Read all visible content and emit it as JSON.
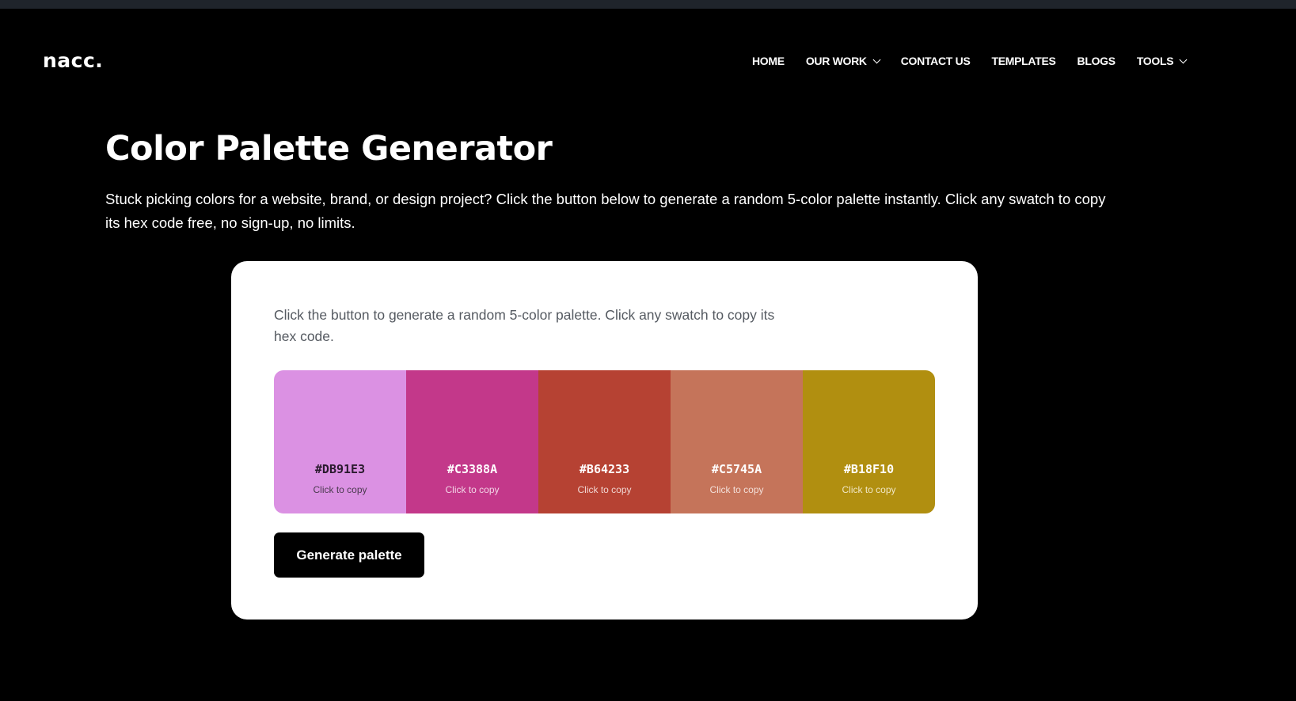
{
  "brand": {
    "logo": "nacc."
  },
  "nav": {
    "items": [
      {
        "label": "HOME",
        "dropdown": false
      },
      {
        "label": "OUR WORK",
        "dropdown": true
      },
      {
        "label": "CONTACT US",
        "dropdown": false
      },
      {
        "label": "TEMPLATES",
        "dropdown": false
      },
      {
        "label": "BLOGS",
        "dropdown": false
      },
      {
        "label": "TOOLS",
        "dropdown": true
      }
    ]
  },
  "main": {
    "title": "Color Palette Generator",
    "intro": "Stuck picking colors for a website, brand, or design project? Click the button below to generate a random 5-color palette instantly. Click any swatch to copy its hex code free, no sign-up, no limits."
  },
  "tool": {
    "description": "Click the button to generate a random 5-color palette. Click any swatch to copy its hex code.",
    "swatches": [
      {
        "hex": "#DB91E3",
        "color": "#DB91E3",
        "text_color": "#2a1a2e",
        "sub_color": "#4a3a4e",
        "copy_label": "Click to copy"
      },
      {
        "hex": "#C3388A",
        "color": "#C3388A",
        "text_color": "#ffffff",
        "sub_color": "#f2d5e6",
        "copy_label": "Click to copy"
      },
      {
        "hex": "#B64233",
        "color": "#B64233",
        "text_color": "#ffffff",
        "sub_color": "#f0d5d1",
        "copy_label": "Click to copy"
      },
      {
        "hex": "#C5745A",
        "color": "#C5745A",
        "text_color": "#ffffff",
        "sub_color": "#f3dfd8",
        "copy_label": "Click to copy"
      },
      {
        "hex": "#B18F10",
        "color": "#B18F10",
        "text_color": "#ffffff",
        "sub_color": "#f1e7c5",
        "copy_label": "Click to copy"
      }
    ],
    "generate_button": "Generate palette"
  },
  "colors": {
    "page_background": "#000000",
    "top_strip": "#1f242b",
    "card_background": "#ffffff",
    "button_background": "#000000"
  }
}
